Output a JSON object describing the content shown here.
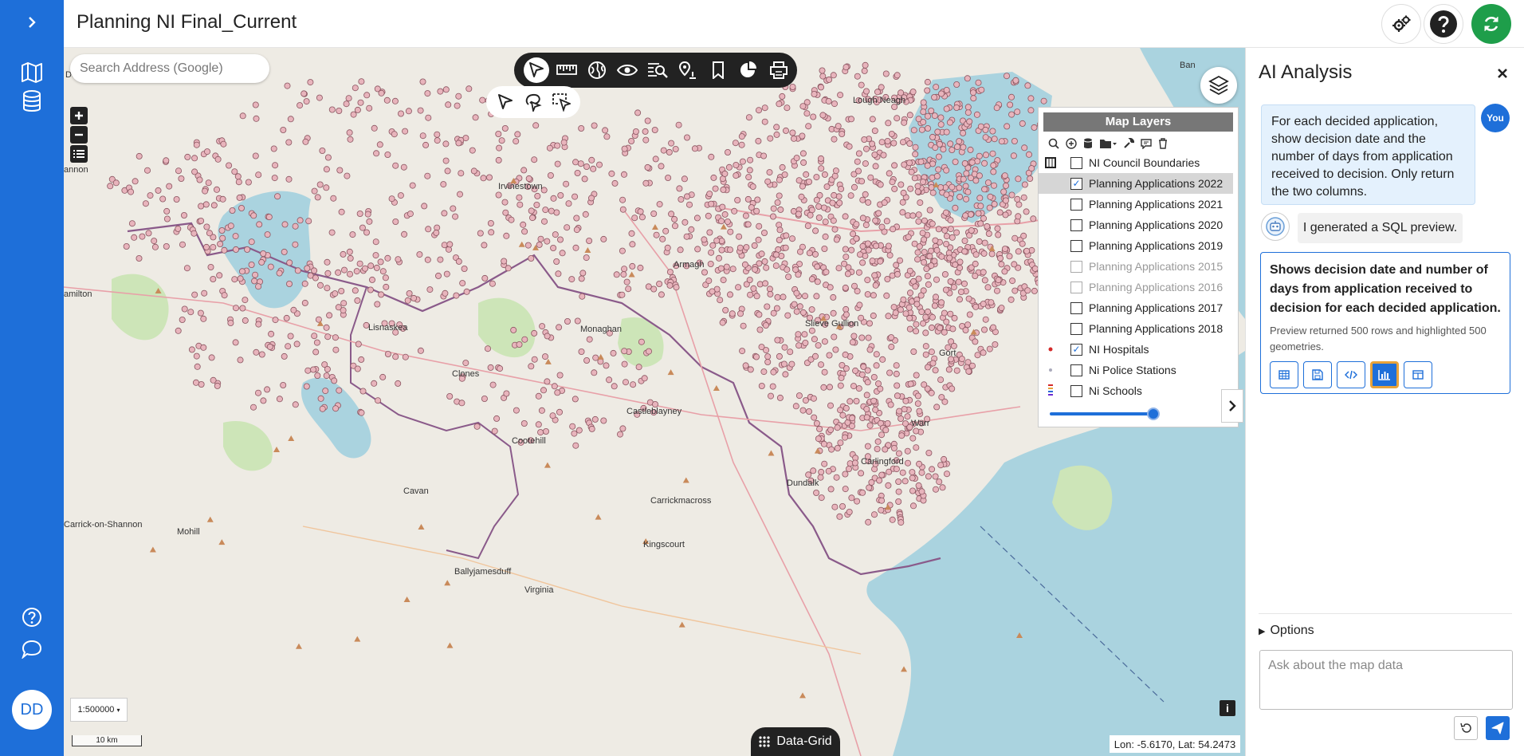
{
  "app": {
    "title": "Planning NI Final_Current",
    "user_initials": "DD"
  },
  "map": {
    "search_placeholder": "Search Address (Google)",
    "scale_select": "1:500000",
    "scalebar_label": "10 km",
    "coords": "Lon: -5.6170, Lat: 54.2473",
    "data_grid_label": "Data-Grid",
    "info_label": "i",
    "places": [
      "Donegal",
      "annon",
      "Irvinestown",
      "amilton",
      "Lisnaskea",
      "Monaghan",
      "Clones",
      "Castleblayney",
      "Cootehill",
      "Cavan",
      "Carrickmacross",
      "Dundalk",
      "Carlingford",
      "Warr",
      "Kingscourt",
      "Carrick-on-Shannon",
      "Mohill",
      "Ballyjamesduff",
      "Virginia",
      "Armagh",
      "Lough Neagh",
      "Ban",
      "Slieve Gullion",
      "Gort"
    ]
  },
  "layers_panel": {
    "title": "Map Layers",
    "layers": [
      {
        "label": "NI Council Boundaries",
        "checked": false,
        "dim": false,
        "selected": false,
        "symbol": "boundary"
      },
      {
        "label": "Planning Applications 2022",
        "checked": true,
        "dim": false,
        "selected": true,
        "symbol": "none"
      },
      {
        "label": "Planning Applications 2021",
        "checked": false,
        "dim": false,
        "selected": false,
        "symbol": "none"
      },
      {
        "label": "Planning Applications 2020",
        "checked": false,
        "dim": false,
        "selected": false,
        "symbol": "none"
      },
      {
        "label": "Planning Applications 2019",
        "checked": false,
        "dim": false,
        "selected": false,
        "symbol": "none"
      },
      {
        "label": "Planning Applications 2015",
        "checked": false,
        "dim": true,
        "selected": false,
        "symbol": "none"
      },
      {
        "label": "Planning Applications 2016",
        "checked": false,
        "dim": true,
        "selected": false,
        "symbol": "none"
      },
      {
        "label": "Planning Applications 2017",
        "checked": false,
        "dim": false,
        "selected": false,
        "symbol": "none"
      },
      {
        "label": "Planning Applications 2018",
        "checked": false,
        "dim": false,
        "selected": false,
        "symbol": "none"
      },
      {
        "label": "NI Hospitals",
        "checked": true,
        "dim": false,
        "selected": false,
        "symbol": "dot-red"
      },
      {
        "label": "Ni Police Stations",
        "checked": false,
        "dim": false,
        "selected": false,
        "symbol": "dot-grey"
      },
      {
        "label": "Ni Schools",
        "checked": false,
        "dim": false,
        "selected": false,
        "symbol": "multi"
      }
    ],
    "opacity": 1.0
  },
  "ai_panel": {
    "title": "AI Analysis",
    "user_label": "You",
    "user_message": "For each decided application, show decision date and the number of days from application received to decision. Only return the two columns.",
    "bot_message": "I generated a SQL preview.",
    "card_title": "Shows decision date and number of days from application received to decision for each decided application.",
    "card_subtitle": "Preview returned 500 rows and highlighted 500 geometries.",
    "options_label": "Options",
    "input_placeholder": "Ask about the map data"
  },
  "colors": {
    "brand": "#1e6fd9",
    "highlight": "#e8a33a",
    "point_fill": "#e8b4bc",
    "point_stroke": "#8a5560"
  }
}
